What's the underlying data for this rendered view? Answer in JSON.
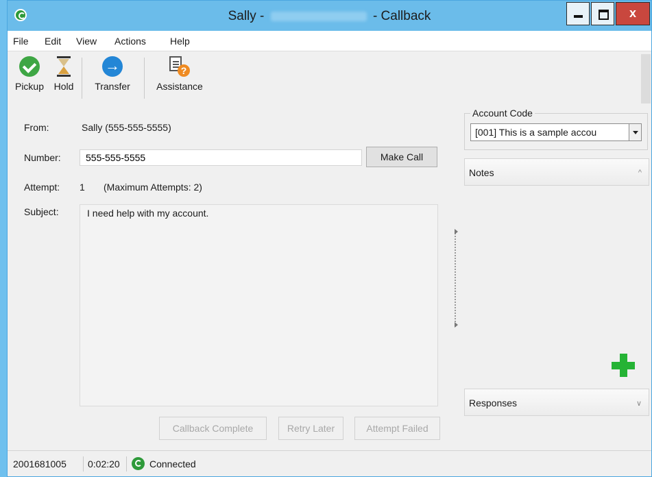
{
  "window": {
    "title_prefix": "Sally -",
    "title_suffix": "- Callback"
  },
  "menu": [
    "File",
    "Edit",
    "View",
    "Actions",
    "Help"
  ],
  "toolbar": {
    "pickup": "Pickup",
    "hold": "Hold",
    "transfer": "Transfer",
    "assistance": "Assistance"
  },
  "form": {
    "from_label": "From:",
    "from_value": "Sally (555-555-5555)",
    "number_label": "Number:",
    "number_value": "555-555-5555",
    "make_call": "Make Call",
    "attempt_label": "Attempt:",
    "attempt_value": "1",
    "max_attempts": "(Maximum Attempts: 2)",
    "subject_label": "Subject:",
    "subject_value": "I need help with my account."
  },
  "actions": {
    "callback_complete": "Callback Complete",
    "retry_later": "Retry Later",
    "attempt_failed": "Attempt Failed"
  },
  "right": {
    "account_code_label": "Account Code",
    "account_code_value": "[001]  This is a sample accou",
    "notes": "Notes",
    "responses": "Responses"
  },
  "status": {
    "id": "2001681005",
    "timer": "0:02:20",
    "state": "Connected"
  },
  "colors": {
    "titlebar": "#6bbcea",
    "pickup_green": "#3ea644",
    "transfer_blue": "#2386d6",
    "add_green": "#25b335",
    "close_red": "#c9473e"
  }
}
